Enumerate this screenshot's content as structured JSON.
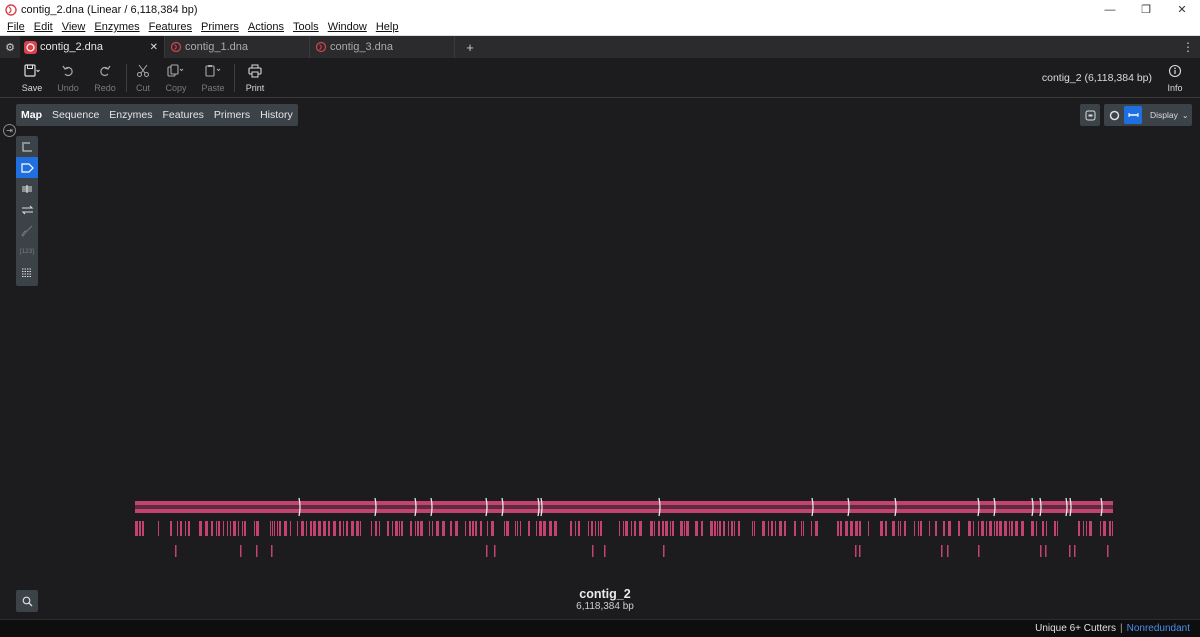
{
  "window": {
    "title": "contig_2.dna  (Linear / 6,118,384 bp)"
  },
  "menu": [
    "File",
    "Edit",
    "View",
    "Enzymes",
    "Features",
    "Primers",
    "Actions",
    "Tools",
    "Window",
    "Help"
  ],
  "tabs": [
    {
      "label": "contig_2.dna",
      "active": true
    },
    {
      "label": "contig_1.dna",
      "active": false
    },
    {
      "label": "contig_3.dna",
      "active": false
    }
  ],
  "toolbar": {
    "save": "Save",
    "undo": "Undo",
    "redo": "Redo",
    "cut": "Cut",
    "copy": "Copy",
    "paste": "Paste",
    "print": "Print",
    "info": "Info",
    "sequence_info": "contig_2  (6,118,384 bp)"
  },
  "view_tabs": [
    "Map",
    "Sequence",
    "Enzymes",
    "Features",
    "Primers",
    "History"
  ],
  "display_button": "Display",
  "map": {
    "name": "contig_2",
    "length": "6,118,384 bp",
    "colors": {
      "track": "#c2436f",
      "feature": "#c2436f",
      "site_marker": "#e8e8e8"
    }
  },
  "status": {
    "enzyme_set": "Unique 6+ Cutters",
    "mode": "Nonredundant"
  }
}
